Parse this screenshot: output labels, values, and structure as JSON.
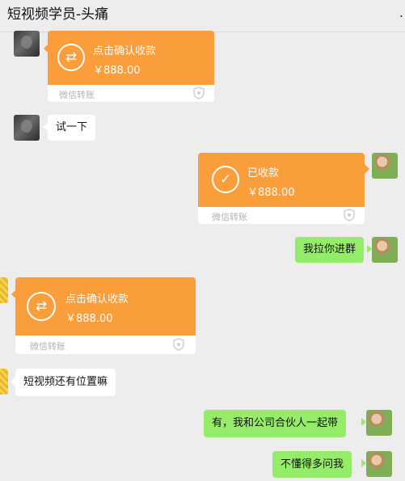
{
  "header": {
    "title": "短视频学员-头痛",
    "more_glyph": "."
  },
  "colors": {
    "transfer_orange": "#fa9d3b",
    "bubble_green": "#95ec69",
    "background": "#ededed"
  },
  "messages": [
    {
      "kind": "transfer",
      "side": "left",
      "title": "点击确认收款",
      "amount": "￥888.00",
      "footer": "微信转账",
      "icon": "transfer-arrows-icon"
    },
    {
      "kind": "text",
      "side": "left",
      "text": "试一下"
    },
    {
      "kind": "transfer",
      "side": "right",
      "title": "已收款",
      "amount": "￥888.00",
      "footer": "微信转账",
      "icon": "check-icon"
    },
    {
      "kind": "text",
      "side": "right",
      "text": "我拉你进群"
    },
    {
      "kind": "transfer",
      "side": "left",
      "title": "点击确认收款",
      "amount": "￥888.00",
      "footer": "微信转账",
      "icon": "transfer-arrows-icon"
    },
    {
      "kind": "text",
      "side": "left",
      "text": "短视频还有位置嘛"
    },
    {
      "kind": "text",
      "side": "right",
      "text": "有，我和公司合伙人一起带"
    },
    {
      "kind": "text",
      "side": "right",
      "text": "不懂得多问我"
    }
  ]
}
